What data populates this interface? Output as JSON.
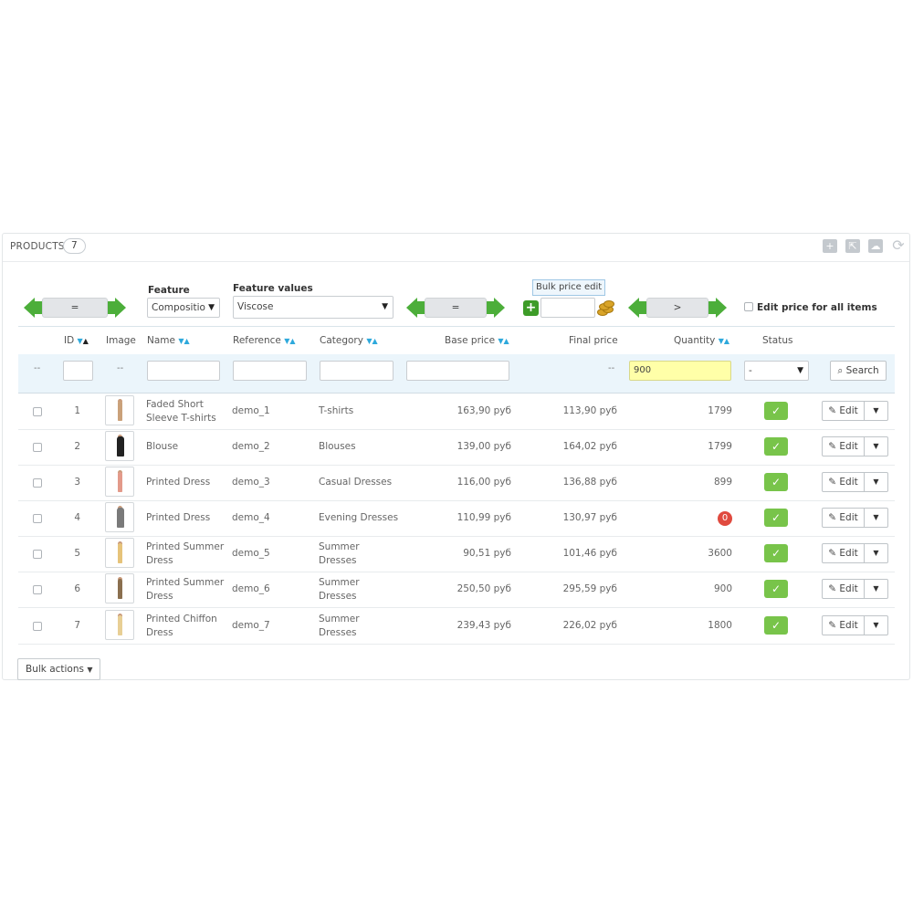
{
  "panel": {
    "title": "PRODUCTS",
    "count": "7"
  },
  "header_tools": [
    "add-icon",
    "export-icon",
    "cloud-upload-icon",
    "refresh-icon"
  ],
  "filters": {
    "arrow1_value": "=",
    "feature_label": "Feature",
    "feature_value": "Compositio",
    "feature_values_label": "Feature values",
    "feature_values_value": "Viscose",
    "arrow2_value": "=",
    "bulk_price_edit_label": "Bulk price edit",
    "arrow3_value": ">",
    "edit_all_label": "Edit price for all items"
  },
  "columns": {
    "id": "ID",
    "image": "Image",
    "name": "Name",
    "reference": "Reference",
    "category": "Category",
    "base_price": "Base price",
    "final_price": "Final price",
    "quantity": "Quantity",
    "status": "Status"
  },
  "filter_row": {
    "dash": "--",
    "quantity_value": "900",
    "status_value": "-",
    "search_label": "Search"
  },
  "rows": [
    {
      "id": "1",
      "name": "Faded Short Sleeve T-shirts",
      "reference": "demo_1",
      "category": "T-shirts",
      "base_price": "163,90 руб",
      "final_price": "113,90 руб",
      "quantity": "1799",
      "status": "enabled",
      "edit": "Edit"
    },
    {
      "id": "2",
      "name": "Blouse",
      "reference": "demo_2",
      "category": "Blouses",
      "base_price": "139,00 руб",
      "final_price": "164,02 руб",
      "quantity": "1799",
      "status": "enabled",
      "edit": "Edit"
    },
    {
      "id": "3",
      "name": "Printed Dress",
      "reference": "demo_3",
      "category": "Casual Dresses",
      "base_price": "116,00 руб",
      "final_price": "136,88 руб",
      "quantity": "899",
      "status": "enabled",
      "edit": "Edit"
    },
    {
      "id": "4",
      "name": "Printed Dress",
      "reference": "demo_4",
      "category": "Evening Dresses",
      "base_price": "110,99 руб",
      "final_price": "130,97 руб",
      "quantity": "0",
      "status": "enabled",
      "edit": "Edit"
    },
    {
      "id": "5",
      "name": "Printed Summer Dress",
      "reference": "demo_5",
      "category": "Summer Dresses",
      "base_price": "90,51 руб",
      "final_price": "101,46 руб",
      "quantity": "3600",
      "status": "enabled",
      "edit": "Edit"
    },
    {
      "id": "6",
      "name": "Printed Summer Dress",
      "reference": "demo_6",
      "category": "Summer Dresses",
      "base_price": "250,50 руб",
      "final_price": "295,59 руб",
      "quantity": "900",
      "status": "enabled",
      "edit": "Edit"
    },
    {
      "id": "7",
      "name": "Printed Chiffon Dress",
      "reference": "demo_7",
      "category": "Summer Dresses",
      "base_price": "239,43 руб",
      "final_price": "226,02 руб",
      "quantity": "1800",
      "status": "enabled",
      "edit": "Edit"
    }
  ],
  "footer": {
    "bulk_actions_label": "Bulk actions"
  },
  "colors": {
    "accent": "#2ea9dc",
    "arrow_green": "#4cae3a",
    "status_green": "#78c44a",
    "zero_badge": "#e04a3f",
    "filter_highlight": "#ffffa8"
  }
}
